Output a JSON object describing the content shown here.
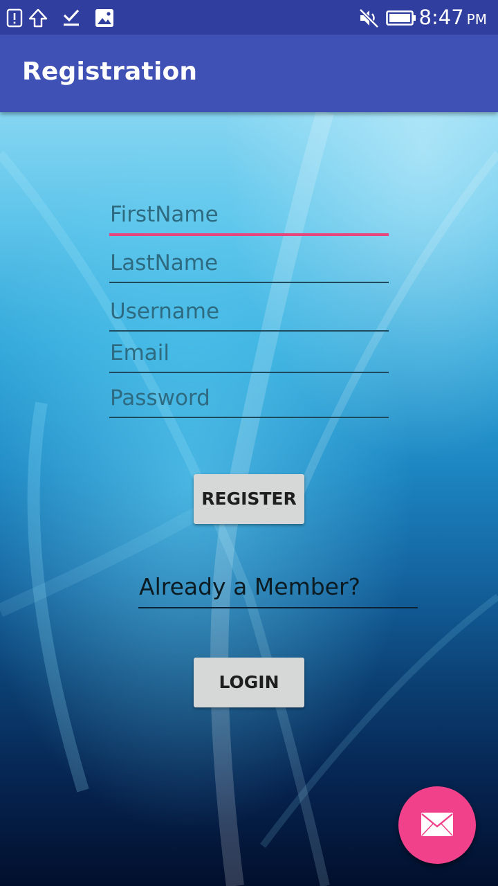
{
  "status_bar": {
    "time": "8:47",
    "ampm": "PM",
    "icons": [
      "alert-icon",
      "upload-icon",
      "download-done-icon",
      "image-icon",
      "mute-icon",
      "battery-icon"
    ]
  },
  "app_bar": {
    "title": "Registration"
  },
  "form": {
    "fields": [
      {
        "placeholder": "FirstName",
        "focused": true
      },
      {
        "placeholder": "LastName",
        "focused": false
      },
      {
        "placeholder": "Username",
        "focused": false
      },
      {
        "placeholder": "Email",
        "focused": false
      },
      {
        "placeholder": "Password",
        "focused": false
      }
    ],
    "register_label": "REGISTER",
    "member_prompt": "Already a Member?",
    "login_label": "LOGIN"
  },
  "fab": {
    "icon": "mail-icon"
  },
  "colors": {
    "primary": "#3f51b5",
    "primary_dark": "#303f9f",
    "accent": "#ff4081",
    "button": "#d6d7d7"
  }
}
